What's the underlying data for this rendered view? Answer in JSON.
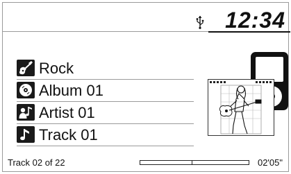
{
  "status_bar": {
    "usb_icon": "usb-icon",
    "clock": "12:34"
  },
  "now_playing": {
    "items": [
      {
        "icon": "guitar-icon",
        "label": "Rock"
      },
      {
        "icon": "album-disc-icon",
        "label": "Album 01"
      },
      {
        "icon": "artist-icon",
        "label": "Artist 01"
      },
      {
        "icon": "music-note-icon",
        "label": "Track 01"
      }
    ],
    "artwork": {
      "device_icon": "ipod-icon",
      "album_art": "guitarist-album-art"
    }
  },
  "footer": {
    "track_count": "Track 02 of 22",
    "progress_fraction": 0.48,
    "elapsed": "02'05\""
  }
}
